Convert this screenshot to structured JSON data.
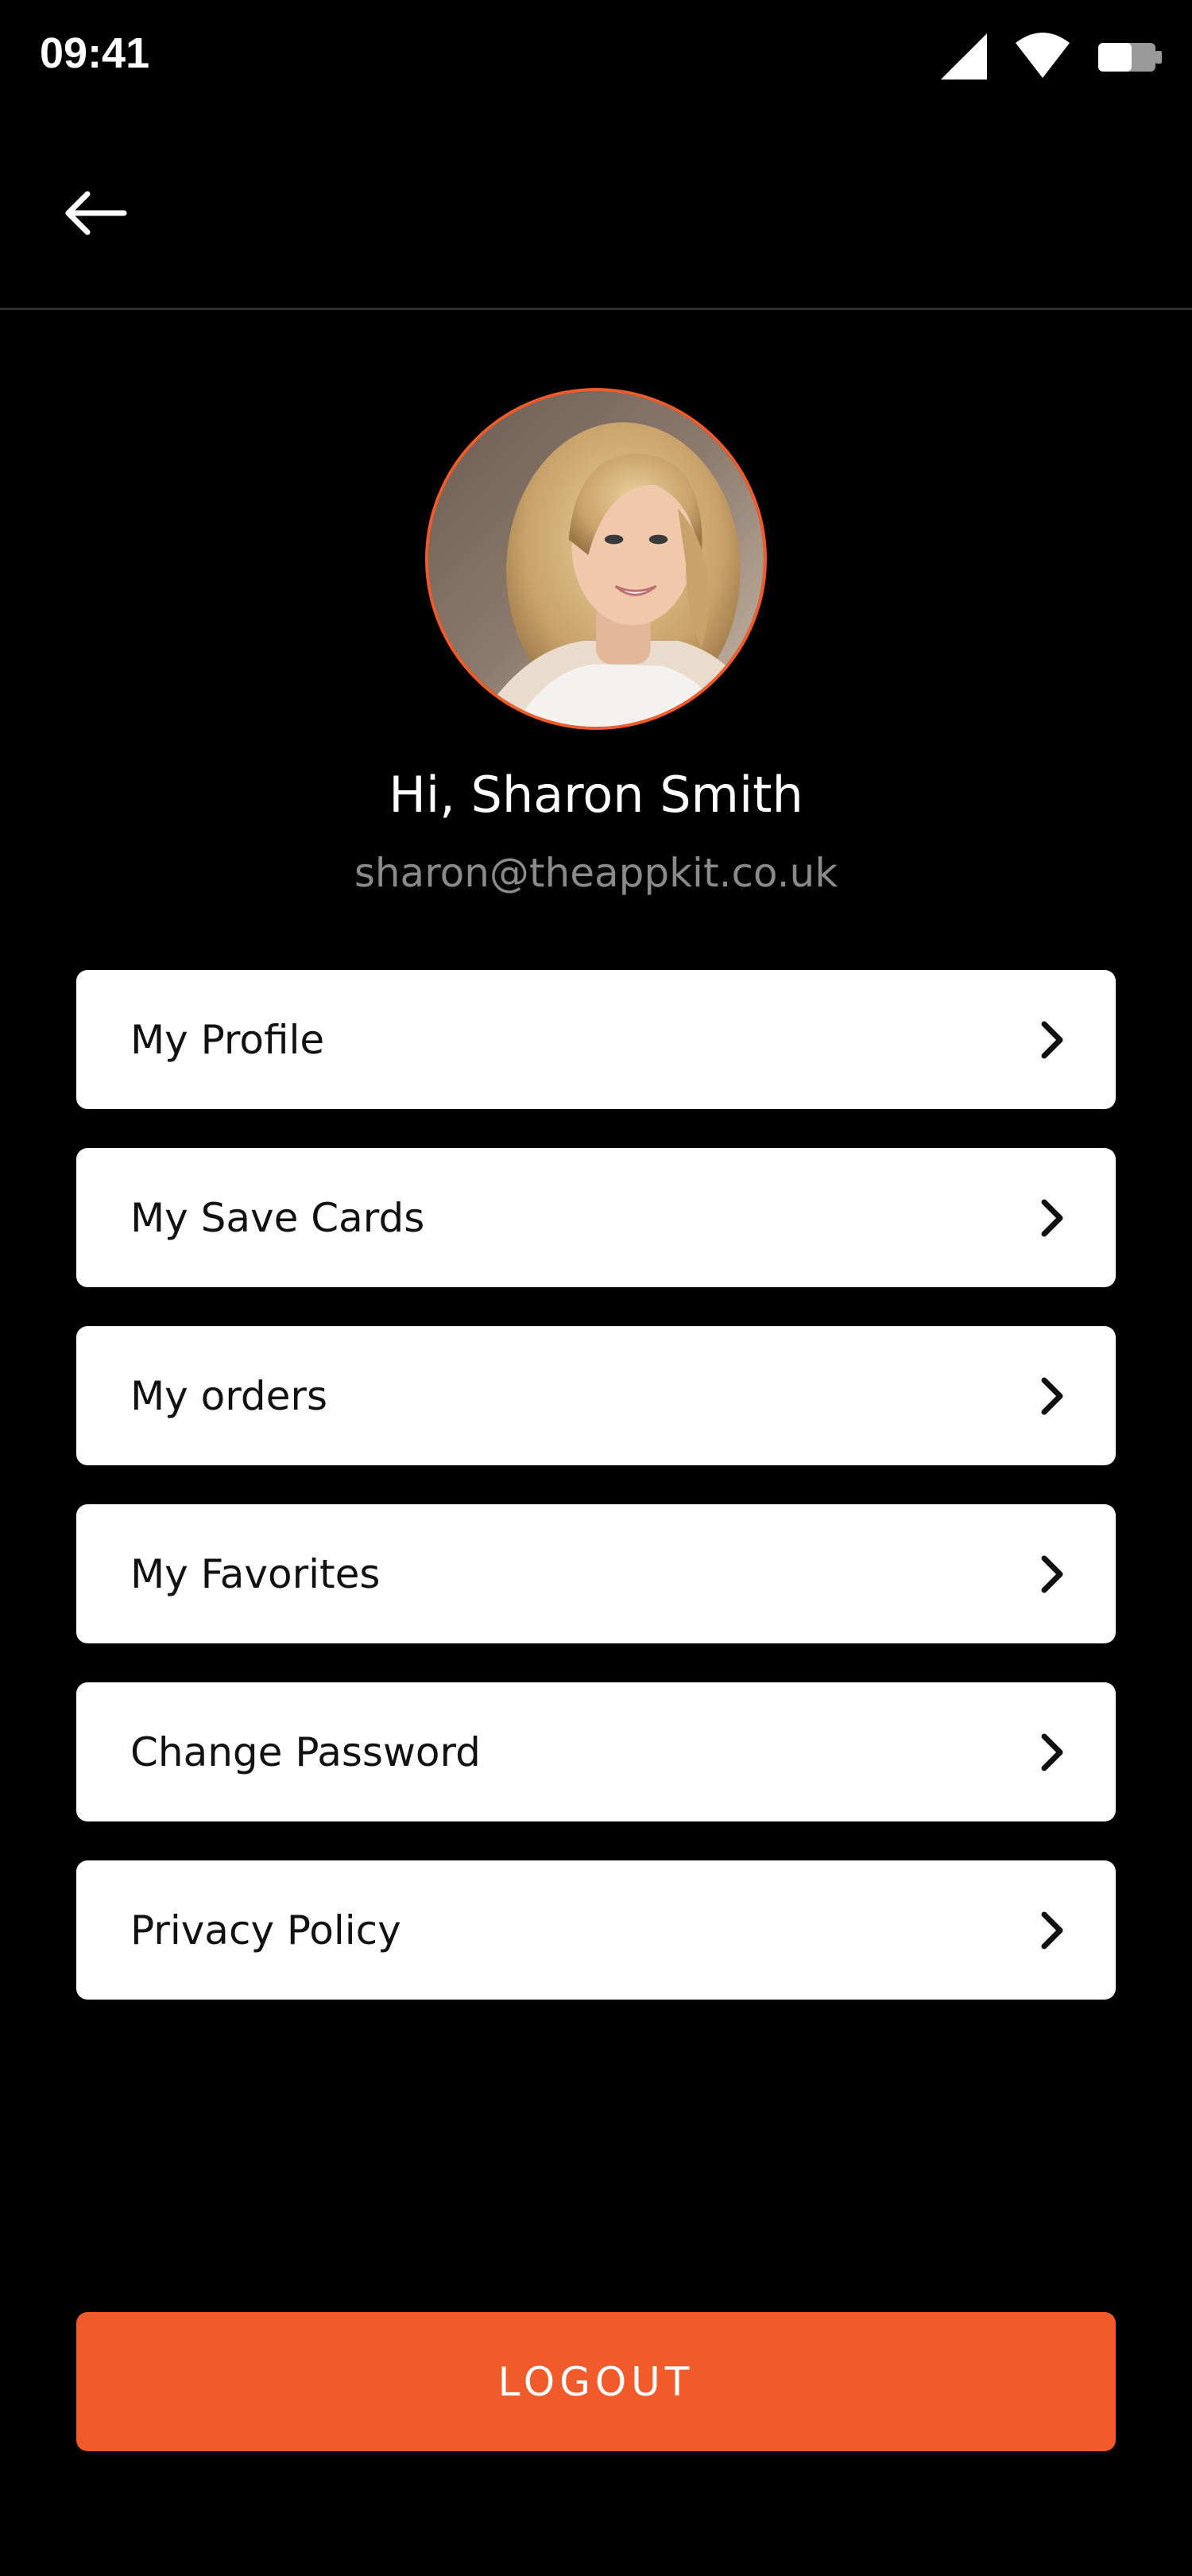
{
  "status_bar": {
    "time": "09:41",
    "icons": [
      "cellular-signal-icon",
      "wifi-icon",
      "battery-icon"
    ]
  },
  "app_bar": {
    "back_icon": "arrow-left-icon"
  },
  "profile": {
    "greeting": "Hi, Sharon Smith",
    "email": "sharon@theappkit.co.uk",
    "avatar_border_color": "#f15a2b"
  },
  "menu": {
    "items": [
      {
        "label": "My Profile"
      },
      {
        "label": "My Save Cards"
      },
      {
        "label": "My orders"
      },
      {
        "label": "My Favorites"
      },
      {
        "label": "Change Password"
      },
      {
        "label": "Privacy Policy"
      }
    ],
    "chevron_icon": "chevron-right-icon"
  },
  "logout": {
    "label": "LOGOUT",
    "color": "#f15a2b"
  },
  "theme": {
    "background": "#000000",
    "card_background": "#ffffff",
    "accent": "#f15a2b",
    "muted_text": "#8a8a8a"
  }
}
